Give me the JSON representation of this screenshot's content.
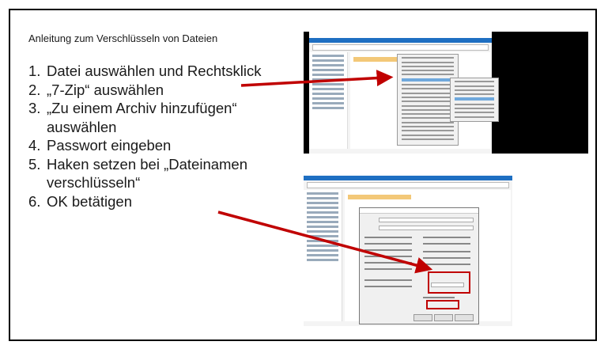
{
  "title": "Anleitung zum Verschlüsseln von Dateien",
  "steps": [
    {
      "num": "1.",
      "text": "Datei auswählen und Rechtsklick"
    },
    {
      "num": "2.",
      "text": "„7-Zip“ auswählen"
    },
    {
      "num": "3.",
      "text": "„Zu einem Archiv hinzufügen“ auswählen"
    },
    {
      "num": "4.",
      "text": "Passwort eingeben"
    },
    {
      "num": "5.",
      "text": "Haken setzen bei „Dateinamen verschlüsseln“"
    },
    {
      "num": "6.",
      "text": "OK betätigen"
    }
  ],
  "colors": {
    "arrow": "#c00000",
    "highlight_box": "#c00000"
  }
}
